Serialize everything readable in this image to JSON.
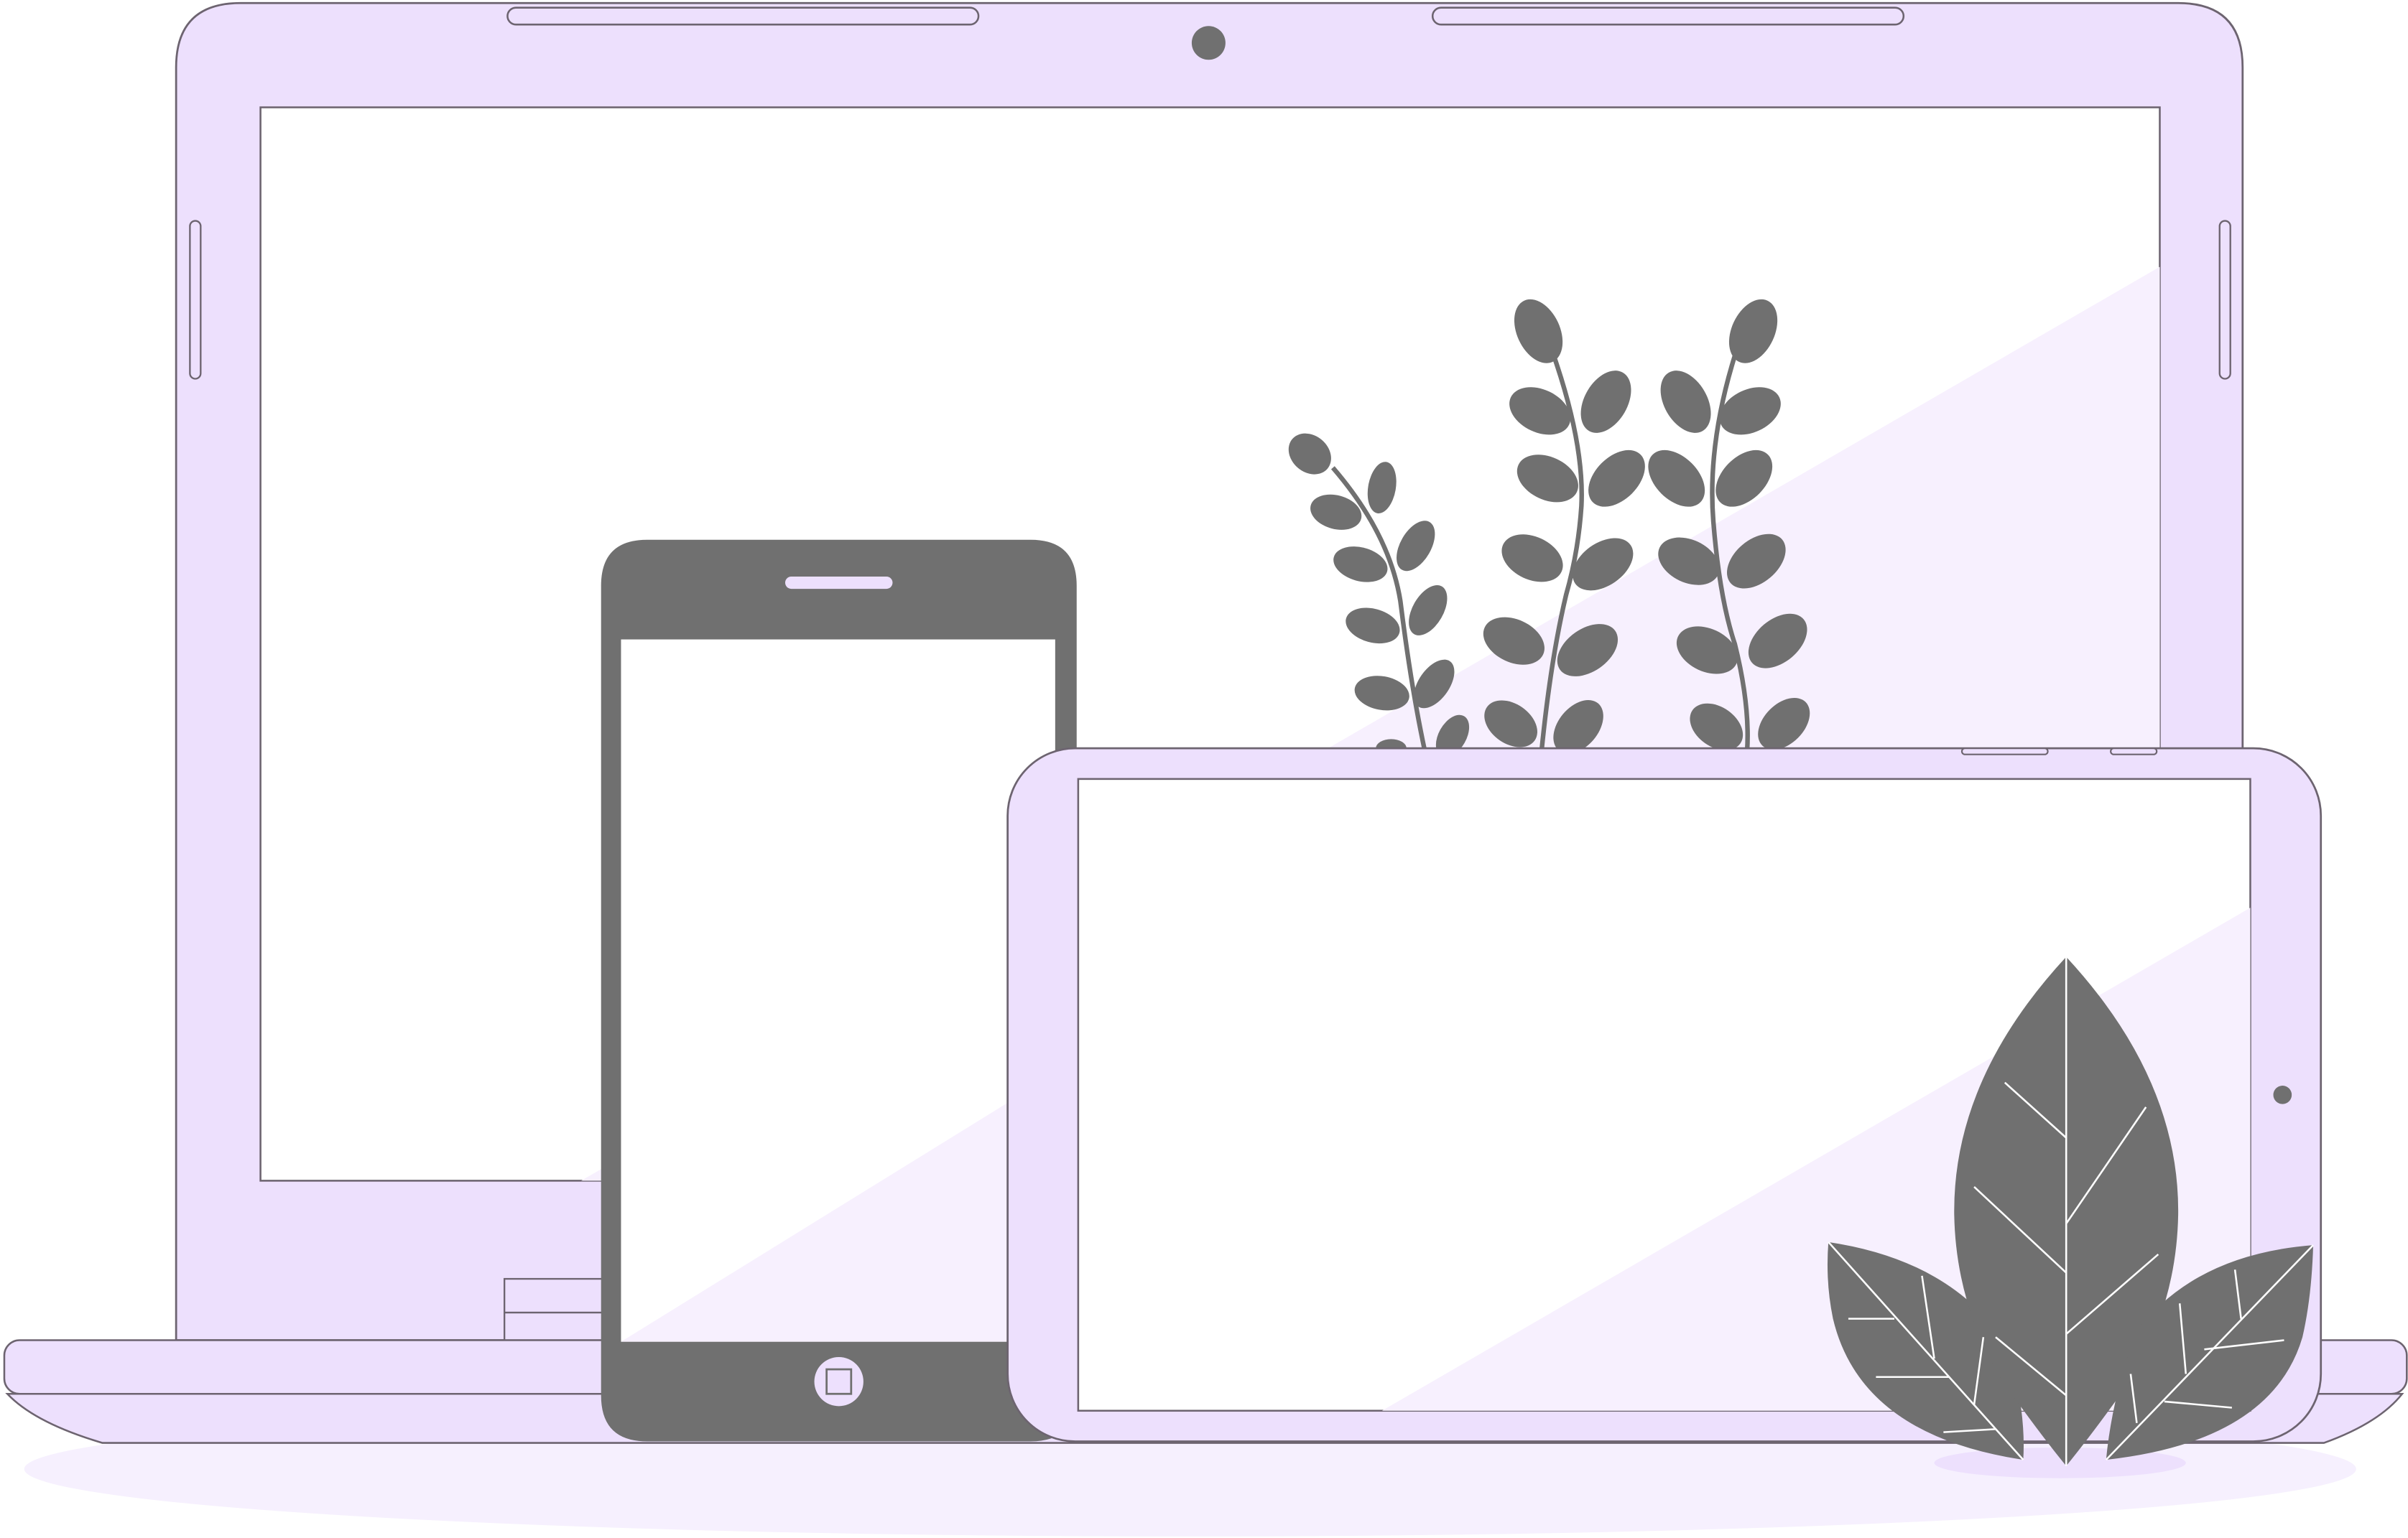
{
  "colors": {
    "device_body": "#ede0fd",
    "screen": "#ffffff",
    "screen_reflection": "#f7f0fe",
    "outline": "#6d6470",
    "phone_body": "#707070",
    "foliage": "#707070",
    "leaf_vein": "#ffffff",
    "floor_shadow": "#f6f0fe",
    "pot_shadow": "#ede0fd"
  },
  "icons": {
    "laptop": "laptop-icon",
    "phone": "smartphone-icon",
    "tablet": "tablet-icon",
    "plant_back": "sprig-plant-icon",
    "plant_front": "leafy-plant-icon"
  }
}
